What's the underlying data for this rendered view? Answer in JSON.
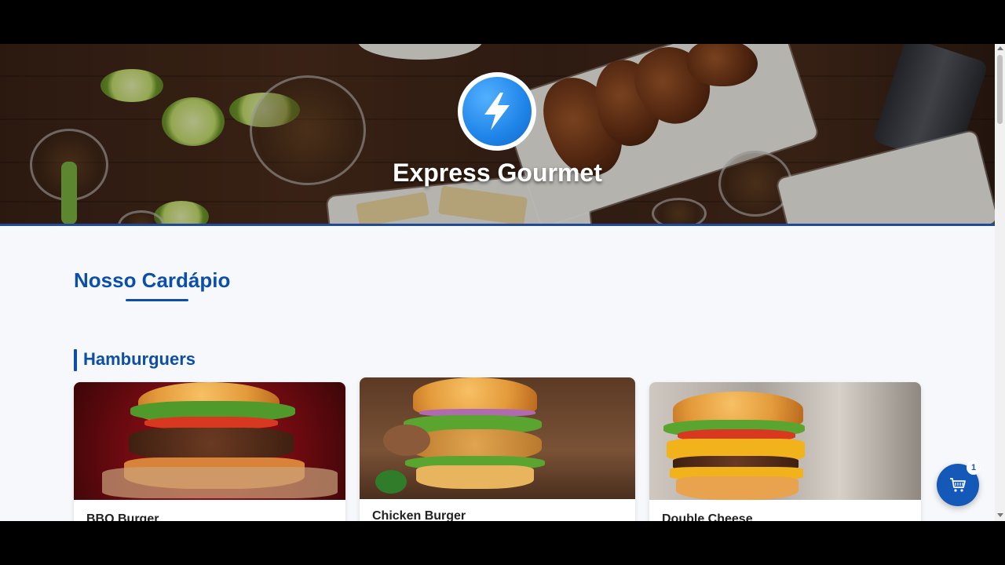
{
  "brand": {
    "name": "Express Gourmet",
    "logo_icon": "lightning-bolt-icon",
    "logo_color": "#1e84e8"
  },
  "menu": {
    "title": "Nosso Cardápio",
    "categories": [
      {
        "title": "Hamburguers",
        "items": [
          {
            "name": "BBQ Burger"
          },
          {
            "name": "Chicken Burger"
          },
          {
            "name": "Double Cheese"
          }
        ]
      }
    ]
  },
  "cart": {
    "icon": "shopping-cart-icon",
    "count": "1"
  },
  "colors": {
    "accent": "#0d4fa8",
    "cart_button": "#1458b8",
    "background": "#f6f8fb"
  }
}
